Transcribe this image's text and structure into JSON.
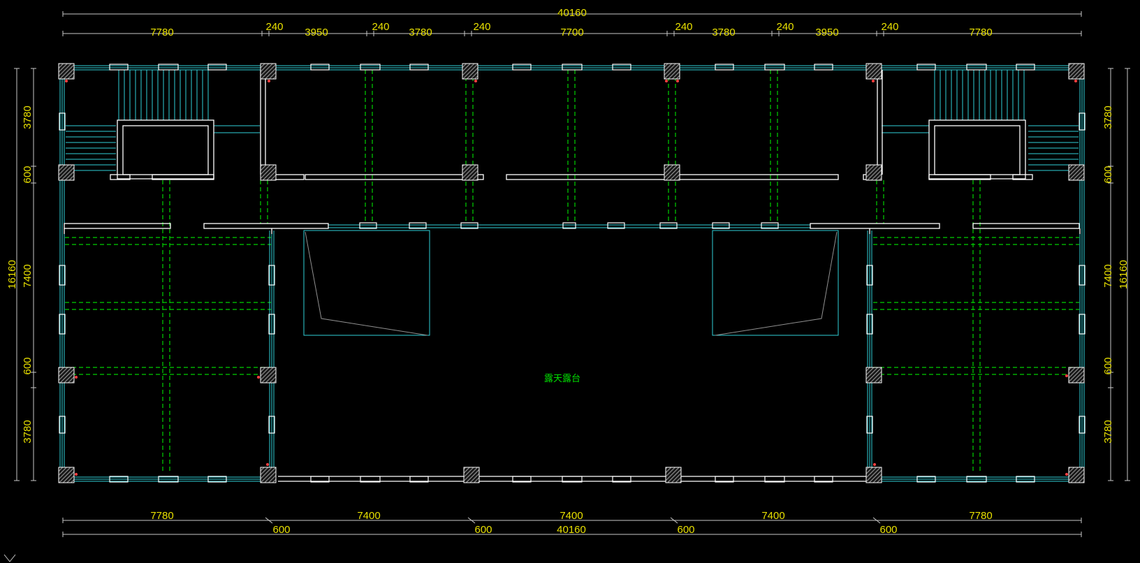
{
  "drawing": {
    "colors": {
      "background": "#000000",
      "dimension": "#e8e000",
      "dim_line": "#c8c8c8",
      "wall": "#ffffff",
      "glass": "#30d0d8",
      "beam": "#00d000",
      "label": "#00e000",
      "column_marker": "#ff4040"
    },
    "terrace_label": "露天露台",
    "dims": {
      "top_total": "40160",
      "top": [
        "7780",
        "240",
        "3950",
        "240",
        "3780",
        "240",
        "7700",
        "240",
        "3780",
        "240",
        "3950",
        "240",
        "7780"
      ],
      "bottom_row1": [
        "7780",
        "7400",
        "7400",
        "7400",
        "7780"
      ],
      "bottom_row2": [
        "600",
        "600",
        "600",
        "600"
      ],
      "bottom_total": "40160",
      "left": [
        "3780",
        "600",
        "7400",
        "600",
        "3780"
      ],
      "left_total": "16160",
      "right": [
        "3780",
        "600",
        "7400",
        "600",
        "3780"
      ],
      "right_total": "16160"
    }
  }
}
